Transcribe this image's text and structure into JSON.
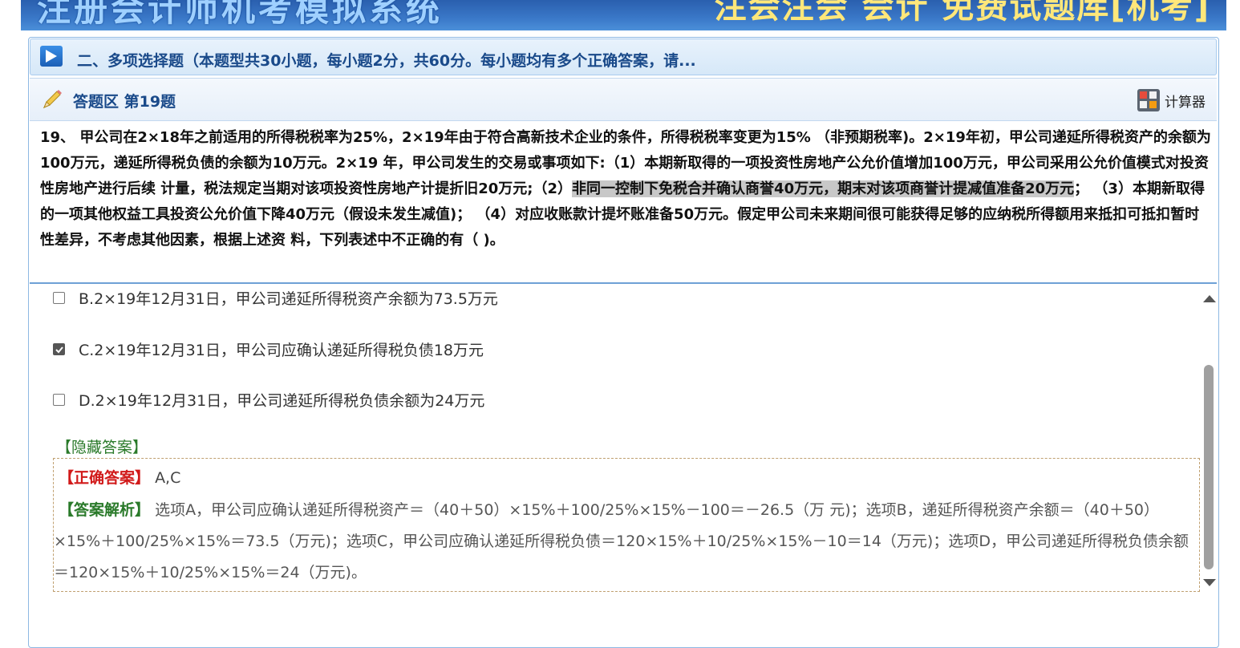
{
  "banner": {
    "left_text": "注册会计师机考模拟系统",
    "right_text": "注会注会 会计 免费试题库[机考]"
  },
  "section": {
    "title": "二、多项选择题（本题型共30小题，每小题2分，共60分。每小题均有多个正确答案，请..."
  },
  "answer_area": {
    "title": "答题区 第19题",
    "calculator_label": "计算器"
  },
  "question": {
    "text_part1": "19、 甲公司在2×18年之前适用的所得税税率为25%，2×19年由于符合高新技术企业的条件，所得税税率变更为15% （非预期税率)。2×19年初，甲公司递延所得税资产的余额为100万元，递延所得税负债的余额为10万元。2×19 年，甲公司发生的交易或事项如下:（1）本期新取得的一项投资性房地产公允价值增加100万元，甲公司采用公允价值模式对投资性房地产进行后续 计量，税法规定当期对该项投资性房地产计提折旧20万元;（2）",
    "text_highlight": "非同一控制下免税合并确认商誉40万元，期末对该项商誉计提减值准备20万元",
    "text_part2": "；  （3）本期新取得的一项其他权益工具投资公允价值下降40万元（假设未发生减值)；  （4）对应收账款计提坏账准备50万元。假定甲公司未来期间很可能获得足够的应纳税所得额用来抵扣可抵扣暂时性差异，不考虑其他因素，根据上述资 料，下列表述中不正确的有（ )。"
  },
  "options": [
    {
      "label": "B.2×19年12月31日，甲公司递延所得税资产余额为73.5万元",
      "checked": false
    },
    {
      "label": "C.2×19年12月31日，甲公司应确认递延所得税负债18万元",
      "checked": true
    },
    {
      "label": "D.2×19年12月31日，甲公司递延所得税负债余额为24万元",
      "checked": false
    }
  ],
  "hide_answer_label": "【隐藏答案】",
  "answer": {
    "correct_tag": "【正确答案】",
    "correct_value": "A,C",
    "analysis_tag": "【答案解析】",
    "analysis_text": "选项A，甲公司应确认递延所得税资产＝（40＋50）×15%＋100/25%×15%－100＝－26.5（万 元)；选项B，递延所得税资产余额＝（40＋50）×15%＋100/25%×15%＝73.5（万元)；选项C，甲公司应确认递延所得税负债＝120×15%＋10/25%×15%－10＝14（万元)；选项D，甲公司递延所得税负债余额＝120×15%＋10/25%×15%＝24（万元)。"
  }
}
